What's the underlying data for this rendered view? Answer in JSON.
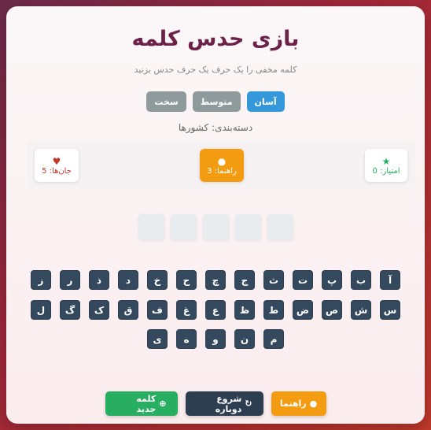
{
  "header": {
    "title": "بازی حدس کلمه",
    "subtitle": "کلمه مخفی را یک حرف یک حرف حدس بزنید"
  },
  "difficulty": {
    "options": [
      "آسان",
      "متوسط",
      "سخت"
    ],
    "selected": "آسان"
  },
  "category": "دسته‌بندی: کشورها",
  "stats": {
    "score": {
      "label": "امتیاز: 0",
      "icon": "star-icon",
      "color": "#27ae60"
    },
    "hints": {
      "label": "راهنما: 3",
      "icon": "lightbulb-icon",
      "color": "#f39c12"
    },
    "lives": {
      "label": "جان‌ها: 5",
      "icon": "heart-icon",
      "color": "#c0392b"
    }
  },
  "word_slots": 5,
  "keyboard": {
    "row1": [
      "آ",
      "ب",
      "پ",
      "ت",
      "ث",
      "ج",
      "چ",
      "ح",
      "خ",
      "د",
      "ذ",
      "ر",
      "ز"
    ],
    "row2": [
      "س",
      "ش",
      "ص",
      "ض",
      "ط",
      "ظ",
      "ع",
      "غ",
      "ف",
      "ق",
      "ک",
      "گ",
      "ل"
    ],
    "row3": [
      "م",
      "ن",
      "و",
      "ه",
      "ی"
    ]
  },
  "actions": {
    "hint": "راهنما",
    "restart": "شروع دوباره",
    "new_word": "کلمه جدید"
  },
  "colors": {
    "accent_blue": "#3498db",
    "hint_orange": "#f39c12",
    "dark_key": "#34495e",
    "green": "#27ae60",
    "title": "#6b2148"
  }
}
